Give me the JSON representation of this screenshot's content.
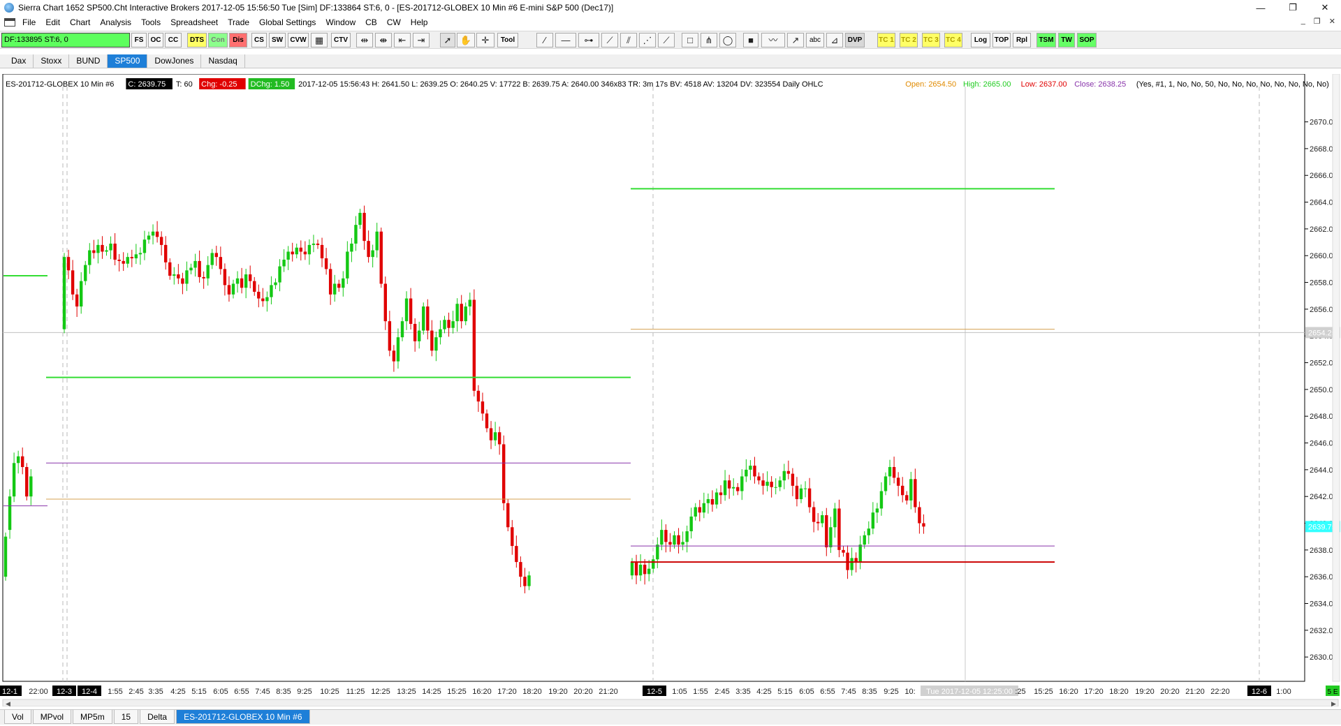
{
  "window": {
    "title": "Sierra Chart 1652 SP500.Cht  Interactive Brokers 2017-12-05  15:56:50 Tue [Sim]  DF:133864  ST:6, 0 - [ES-201712-GLOBEX  10 Min  #6  E-mini S&P 500 (Dec17)]",
    "minimize": "—",
    "maximize": "❐",
    "close": "✕"
  },
  "menu": {
    "items": [
      "File",
      "Edit",
      "Chart",
      "Analysis",
      "Tools",
      "Spreadsheet",
      "Trade",
      "Global Settings",
      "Window",
      "CB",
      "CW",
      "Help"
    ],
    "mdi": [
      "_",
      "❐",
      "✕"
    ]
  },
  "toolbar": {
    "df_label": "DF:133895  ST:6, 0",
    "buttons": [
      "FS",
      "OC",
      "CC",
      "DTS",
      "Con",
      "Dis",
      "CS",
      "SW",
      "CVW",
      "CTV",
      "Tool",
      "abc",
      "DVP",
      "TC 1",
      "TC 2",
      "TC 3",
      "TC 4",
      "Log",
      "TOP",
      "Rpl",
      "TSM",
      "TW",
      "SOP"
    ],
    "icons": [
      "table-icon",
      "zoom-in-icon",
      "zoom-out-icon",
      "scroll-left-icon",
      "scroll-right-icon",
      "pointer-icon",
      "hand-icon",
      "crosshair-icon",
      "ray-icon",
      "line-icon",
      "hline-icon",
      "extend-line-icon",
      "trend-icon",
      "channel-icon",
      "fib-icon",
      "rectangle-icon",
      "pitchfork-icon",
      "square-icon",
      "wave-icon",
      "arrow-icon",
      "ruler-icon"
    ]
  },
  "chartbook_tabs": [
    "Dax",
    "Stoxx",
    "BUND",
    "SP500",
    "DowJones",
    "Nasdaq"
  ],
  "chartbook_active": "SP500",
  "colors": {
    "up": "#14c814",
    "down": "#e00000",
    "green_line": "#33dd33",
    "orange_line": "#d4a050",
    "purple_line": "#8833aa",
    "red_line": "#cc0000",
    "price_badge": "#33ffff",
    "ref_badge": "#d0d0d0"
  },
  "chart_data": {
    "type": "candlestick",
    "header": {
      "symbol": "ES-201712-GLOBEX  10 Min  #6",
      "close_badge": "C: 2639.75",
      "trades": "T: 60",
      "chg_badge": "Chg: -0.25",
      "dchg_badge": "DChg: 1.50",
      "details": "2017-12-05 15:56:43 H: 2641.50 L: 2639.25 O: 2640.25 V: 17722 B: 2639.75 A: 2640.00 346x83 TR: 3m 17s BV: 4518 AV: 13204 DV: 323554  Daily OHLC",
      "open_label": "Open: 2654.50",
      "high_label": "High: 2665.00",
      "low_label": "Low: 2637.00",
      "close_label": "Close: 2638.25",
      "inputs": "(Yes, #1, 1, No, No, 50, No, No, No, No, No, No, No, No)"
    },
    "ylim": [
      2628.6,
      2671.7
    ],
    "y_ticks": [
      "2670.00",
      "2668.00",
      "2666.00",
      "2664.00",
      "2662.00",
      "2660.00",
      "2658.00",
      "2656.00",
      "2654.00",
      "2652.00",
      "2650.00",
      "2648.00",
      "2646.00",
      "2644.00",
      "2642.00",
      "2640.00",
      "2638.00",
      "2636.00",
      "2634.00",
      "2632.00",
      "2630.00"
    ],
    "last_price": "2639.75",
    "ref_price": "2654.25",
    "x_labels": [
      {
        "t": "12-1",
        "x": 14,
        "badge": true
      },
      {
        "t": "22:00",
        "x": 55
      },
      {
        "t": "12-3",
        "x": 92,
        "badge": true
      },
      {
        "t": "12-4",
        "x": 128,
        "badge": true
      },
      {
        "t": "1:55",
        "x": 165
      },
      {
        "t": "2:45",
        "x": 195
      },
      {
        "t": "3:35",
        "x": 223
      },
      {
        "t": "4:25",
        "x": 255
      },
      {
        "t": "5:15",
        "x": 285
      },
      {
        "t": "6:05",
        "x": 316
      },
      {
        "t": "6:55",
        "x": 346
      },
      {
        "t": "7:45",
        "x": 376
      },
      {
        "t": "8:35",
        "x": 406
      },
      {
        "t": "9:25",
        "x": 436
      },
      {
        "t": "10:25",
        "x": 472
      },
      {
        "t": "11:25",
        "x": 509
      },
      {
        "t": "12:25",
        "x": 545
      },
      {
        "t": "13:25",
        "x": 582
      },
      {
        "t": "14:25",
        "x": 618
      },
      {
        "t": "15:25",
        "x": 654
      },
      {
        "t": "16:20",
        "x": 690
      },
      {
        "t": "17:20",
        "x": 726
      },
      {
        "t": "18:20",
        "x": 762
      },
      {
        "t": "19:20",
        "x": 799
      },
      {
        "t": "20:20",
        "x": 835
      },
      {
        "t": "21:20",
        "x": 871
      },
      {
        "t": "12-5",
        "x": 937,
        "badge": true
      },
      {
        "t": "1:05",
        "x": 973
      },
      {
        "t": "1:55",
        "x": 1003
      },
      {
        "t": "2:45",
        "x": 1034
      },
      {
        "t": "3:35",
        "x": 1064
      },
      {
        "t": "4:25",
        "x": 1094
      },
      {
        "t": "5:15",
        "x": 1124
      },
      {
        "t": "6:05",
        "x": 1155
      },
      {
        "t": "6:55",
        "x": 1185
      },
      {
        "t": "7:45",
        "x": 1215
      },
      {
        "t": "8:35",
        "x": 1245
      },
      {
        "t": "9:25",
        "x": 1276
      },
      {
        "t": "10:",
        "x": 1303
      },
      {
        "t": "Tue 2017-12-05  12:25:00",
        "x": 1388,
        "cursor": true
      },
      {
        "t": ":25",
        "x": 1461
      },
      {
        "t": "15:25",
        "x": 1494
      },
      {
        "t": "16:20",
        "x": 1530
      },
      {
        "t": "17:20",
        "x": 1566
      },
      {
        "t": "18:20",
        "x": 1602
      },
      {
        "t": "19:20",
        "x": 1639
      },
      {
        "t": "20:20",
        "x": 1675
      },
      {
        "t": "21:20",
        "x": 1711
      },
      {
        "t": "22:20",
        "x": 1747
      },
      {
        "t": "12-6",
        "x": 1803,
        "badge": true
      },
      {
        "t": "1:00",
        "x": 1838
      }
    ],
    "corner_label": "5 E",
    "levels": [
      {
        "price": 2658.5,
        "color": "#33dd33",
        "from": 5,
        "to": 68,
        "w": 2
      },
      {
        "price": 2650.9,
        "color": "#33dd33",
        "from": 66,
        "to": 903,
        "w": 2
      },
      {
        "price": 2644.5,
        "color": "#8833aa",
        "from": 66,
        "to": 903,
        "w": 1
      },
      {
        "price": 2641.8,
        "color": "#d4a050",
        "from": 66,
        "to": 903,
        "w": 1
      },
      {
        "price": 2641.3,
        "color": "#8833aa",
        "from": 5,
        "to": 68,
        "w": 1
      },
      {
        "price": 2665.0,
        "color": "#33dd33",
        "from": 903,
        "to": 1510,
        "w": 2
      },
      {
        "price": 2654.5,
        "color": "#d4a050",
        "from": 903,
        "to": 1510,
        "w": 1
      },
      {
        "price": 2638.3,
        "color": "#8833aa",
        "from": 903,
        "to": 1510,
        "w": 1
      },
      {
        "price": 2637.1,
        "color": "#cc0000",
        "from": 903,
        "to": 1510,
        "w": 2
      }
    ],
    "vlines": [
      {
        "x": 90,
        "dash": true
      },
      {
        "x": 96,
        "dash": true
      },
      {
        "x": 935,
        "dash": true
      },
      {
        "x": 1803,
        "dash": true
      },
      {
        "x": 1382,
        "dash": false
      }
    ],
    "hline_ref": 2654.25,
    "segments": [
      {
        "start_x": 8,
        "step": 6.05,
        "points": [
          [
            2636,
            2639
          ],
          [
            2639.5,
            2642
          ],
          [
            2642,
            2644.5
          ],
          [
            2644.5,
            2645
          ],
          [
            2645,
            2644.2
          ],
          [
            2644.2,
            2642
          ],
          [
            2642,
            2643.5
          ]
        ]
      },
      {
        "start_x": 92,
        "step": 6.05,
        "points": [
          [
            2654.5,
            2659.9
          ],
          [
            2659.9,
            2658.9
          ],
          [
            2658.9,
            2657.1
          ],
          [
            2657.1,
            2656.2
          ],
          [
            2656.2,
            2658.1
          ],
          [
            2658.1,
            2659.3
          ],
          [
            2659.3,
            2660.4
          ],
          [
            2660.4,
            2660.2
          ],
          [
            2660.2,
            2660.8
          ],
          [
            2660.8,
            2660.3
          ],
          [
            2660.3,
            2660.4
          ],
          [
            2660.4,
            2660.9
          ],
          [
            2660.9,
            2659.7
          ],
          [
            2659.7,
            2659.6
          ],
          [
            2659.6,
            2659.4
          ],
          [
            2659.4,
            2659.9
          ],
          [
            2659.9,
            2659.8
          ],
          [
            2659.8,
            2660.1
          ],
          [
            2660.1,
            2660.2
          ],
          [
            2660.2,
            2661.2
          ],
          [
            2661.2,
            2661.5
          ],
          [
            2661.5,
            2661.8
          ],
          [
            2661.8,
            2661.4
          ],
          [
            2661.4,
            2660.8
          ],
          [
            2660.8,
            2659.5
          ],
          [
            2659.5,
            2658.5
          ],
          [
            2658.5,
            2658.6
          ],
          [
            2658.6,
            2658.3
          ],
          [
            2658.3,
            2657.9
          ],
          [
            2657.9,
            2658.9
          ],
          [
            2658.9,
            2659.1
          ],
          [
            2659.1,
            2659.6
          ],
          [
            2659.6,
            2658.4
          ],
          [
            2658.4,
            2658.3
          ],
          [
            2658.3,
            2659.3
          ],
          [
            2659.3,
            2660.2
          ],
          [
            2660.2,
            2659.9
          ],
          [
            2659.9,
            2659
          ],
          [
            2659,
            2657.8
          ],
          [
            2657.8,
            2657.1
          ],
          [
            2657.1,
            2657.9
          ],
          [
            2657.9,
            2658.3
          ],
          [
            2658.3,
            2657.6
          ],
          [
            2657.6,
            2658.6
          ],
          [
            2658.6,
            2658.1
          ],
          [
            2658.1,
            2657.3
          ],
          [
            2657.3,
            2656.8
          ],
          [
            2656.8,
            2656.6
          ],
          [
            2656.6,
            2656.9
          ],
          [
            2656.9,
            2657.8
          ],
          [
            2657.8,
            2658
          ],
          [
            2658,
            2659.2
          ],
          [
            2659.2,
            2659.7
          ],
          [
            2659.7,
            2660.3
          ],
          [
            2660.3,
            2660.1
          ],
          [
            2660.1,
            2660.6
          ],
          [
            2660.6,
            2660.3
          ],
          [
            2660.3,
            2660.1
          ],
          [
            2660.1,
            2660.8
          ],
          [
            2660.8,
            2660.9
          ],
          [
            2660.9,
            2660.8
          ],
          [
            2660.8,
            2659.8
          ],
          [
            2659.8,
            2659
          ],
          [
            2659,
            2657.1
          ],
          [
            2657.1,
            2657.9
          ],
          [
            2657.9,
            2657.6
          ],
          [
            2657.6,
            2658.3
          ],
          [
            2658.3,
            2660.3
          ],
          [
            2660.3,
            2660.9
          ],
          [
            2660.9,
            2662.3
          ],
          [
            2662.3,
            2663.2
          ],
          [
            2663.2,
            2661.1
          ],
          [
            2661.1,
            2659.9
          ],
          [
            2659.9,
            2660.4
          ],
          [
            2660.4,
            2661.8
          ],
          [
            2661.8,
            2657.9
          ],
          [
            2657.9,
            2655.1
          ],
          [
            2655.1,
            2652.9
          ],
          [
            2652.9,
            2652.1
          ],
          [
            2652.1,
            2653.9
          ],
          [
            2653.9,
            2655.1
          ],
          [
            2655.1,
            2656.8
          ],
          [
            2656.8,
            2654.9
          ],
          [
            2654.9,
            2653.6
          ],
          [
            2653.6,
            2654.4
          ],
          [
            2654.4,
            2656.2
          ],
          [
            2656.2,
            2654.4
          ],
          [
            2654.4,
            2652.9
          ],
          [
            2652.9,
            2653.9
          ],
          [
            2653.9,
            2654.5
          ],
          [
            2654.5,
            2655.2
          ],
          [
            2655.2,
            2654.6
          ],
          [
            2654.6,
            2655.1
          ],
          [
            2655.1,
            2656.4
          ],
          [
            2656.4,
            2655.1
          ],
          [
            2655.1,
            2656.2
          ],
          [
            2656.2,
            2656.7
          ],
          [
            2656.7,
            2649.9
          ],
          [
            2649.9,
            2649.1
          ],
          [
            2649.1,
            2648.2
          ],
          [
            2648.2,
            2647.1
          ],
          [
            2647.1,
            2646.2
          ],
          [
            2646.2,
            2646.8
          ],
          [
            2646.8,
            2645.9
          ],
          [
            2645.9,
            2641.5
          ],
          [
            2641.5,
            2639.7
          ],
          [
            2639.7,
            2638.3
          ],
          [
            2638.3,
            2637.1
          ],
          [
            2637.1,
            2636
          ],
          [
            2636,
            2635.3
          ],
          [
            2635.3,
            2636.1
          ]
        ]
      },
      {
        "start_x": 905,
        "step": 6.05,
        "points": [
          [
            2636.1,
            2637.1
          ],
          [
            2637.1,
            2636.1
          ],
          [
            2636.1,
            2636.9
          ],
          [
            2636.9,
            2636.2
          ],
          [
            2636.2,
            2636.6
          ],
          [
            2636.6,
            2637.3
          ],
          [
            2637.3,
            2638.4
          ],
          [
            2638.4,
            2639.5
          ],
          [
            2639.5,
            2638.6
          ],
          [
            2638.6,
            2638.4
          ],
          [
            2638.4,
            2639.1
          ],
          [
            2639.1,
            2638.4
          ],
          [
            2638.4,
            2638.6
          ],
          [
            2638.6,
            2639.4
          ],
          [
            2639.4,
            2640.5
          ],
          [
            2640.5,
            2641.2
          ],
          [
            2641.2,
            2640.8
          ],
          [
            2640.8,
            2641.5
          ],
          [
            2641.5,
            2641.8
          ],
          [
            2641.8,
            2641.4
          ],
          [
            2641.4,
            2642.3
          ],
          [
            2642.3,
            2642.1
          ],
          [
            2642.1,
            2643.2
          ],
          [
            2643.2,
            2642.6
          ],
          [
            2642.6,
            2642.7
          ],
          [
            2642.7,
            2642.4
          ],
          [
            2642.4,
            2643.5
          ],
          [
            2643.5,
            2644
          ],
          [
            2644,
            2644.3
          ],
          [
            2644.3,
            2643.5
          ],
          [
            2643.5,
            2643.2
          ],
          [
            2643.2,
            2642.8
          ],
          [
            2642.8,
            2643.1
          ],
          [
            2643.1,
            2642.7
          ],
          [
            2642.7,
            2642.7
          ],
          [
            2642.7,
            2643.2
          ],
          [
            2643.2,
            2643.9
          ],
          [
            2643.9,
            2643.7
          ],
          [
            2643.7,
            2642.8
          ],
          [
            2642.8,
            2641.8
          ],
          [
            2641.8,
            2642.6
          ],
          [
            2642.6,
            2642.6
          ],
          [
            2642.6,
            2641.2
          ],
          [
            2641.2,
            2640.1
          ],
          [
            2640.1,
            2640
          ],
          [
            2640,
            2640.6
          ],
          [
            2640.6,
            2638.2
          ],
          [
            2638.2,
            2639.7
          ],
          [
            2639.7,
            2641.1
          ],
          [
            2641.1,
            2638
          ],
          [
            2638,
            2637.8
          ],
          [
            2637.8,
            2636.5
          ],
          [
            2636.5,
            2637.4
          ],
          [
            2637.4,
            2637.1
          ],
          [
            2637.1,
            2638.4
          ],
          [
            2638.4,
            2639.1
          ],
          [
            2639.1,
            2639.6
          ],
          [
            2639.6,
            2640.8
          ],
          [
            2640.8,
            2641.1
          ],
          [
            2641.1,
            2642.4
          ],
          [
            2642.4,
            2643.5
          ],
          [
            2643.5,
            2644.2
          ],
          [
            2644.2,
            2643.4
          ],
          [
            2643.4,
            2642.8
          ],
          [
            2642.8,
            2642.1
          ],
          [
            2642.1,
            2641.7
          ],
          [
            2641.7,
            2643.3
          ],
          [
            2643.3,
            2641.2
          ],
          [
            2641.2,
            2640
          ],
          [
            2640,
            2639.75
          ]
        ]
      }
    ]
  },
  "bottom_tabs": [
    "Vol",
    "MPvol",
    "MP5m",
    "15",
    "Delta",
    "ES-201712-GLOBEX  10 Min  #6"
  ],
  "bottom_active": "ES-201712-GLOBEX  10 Min  #6"
}
